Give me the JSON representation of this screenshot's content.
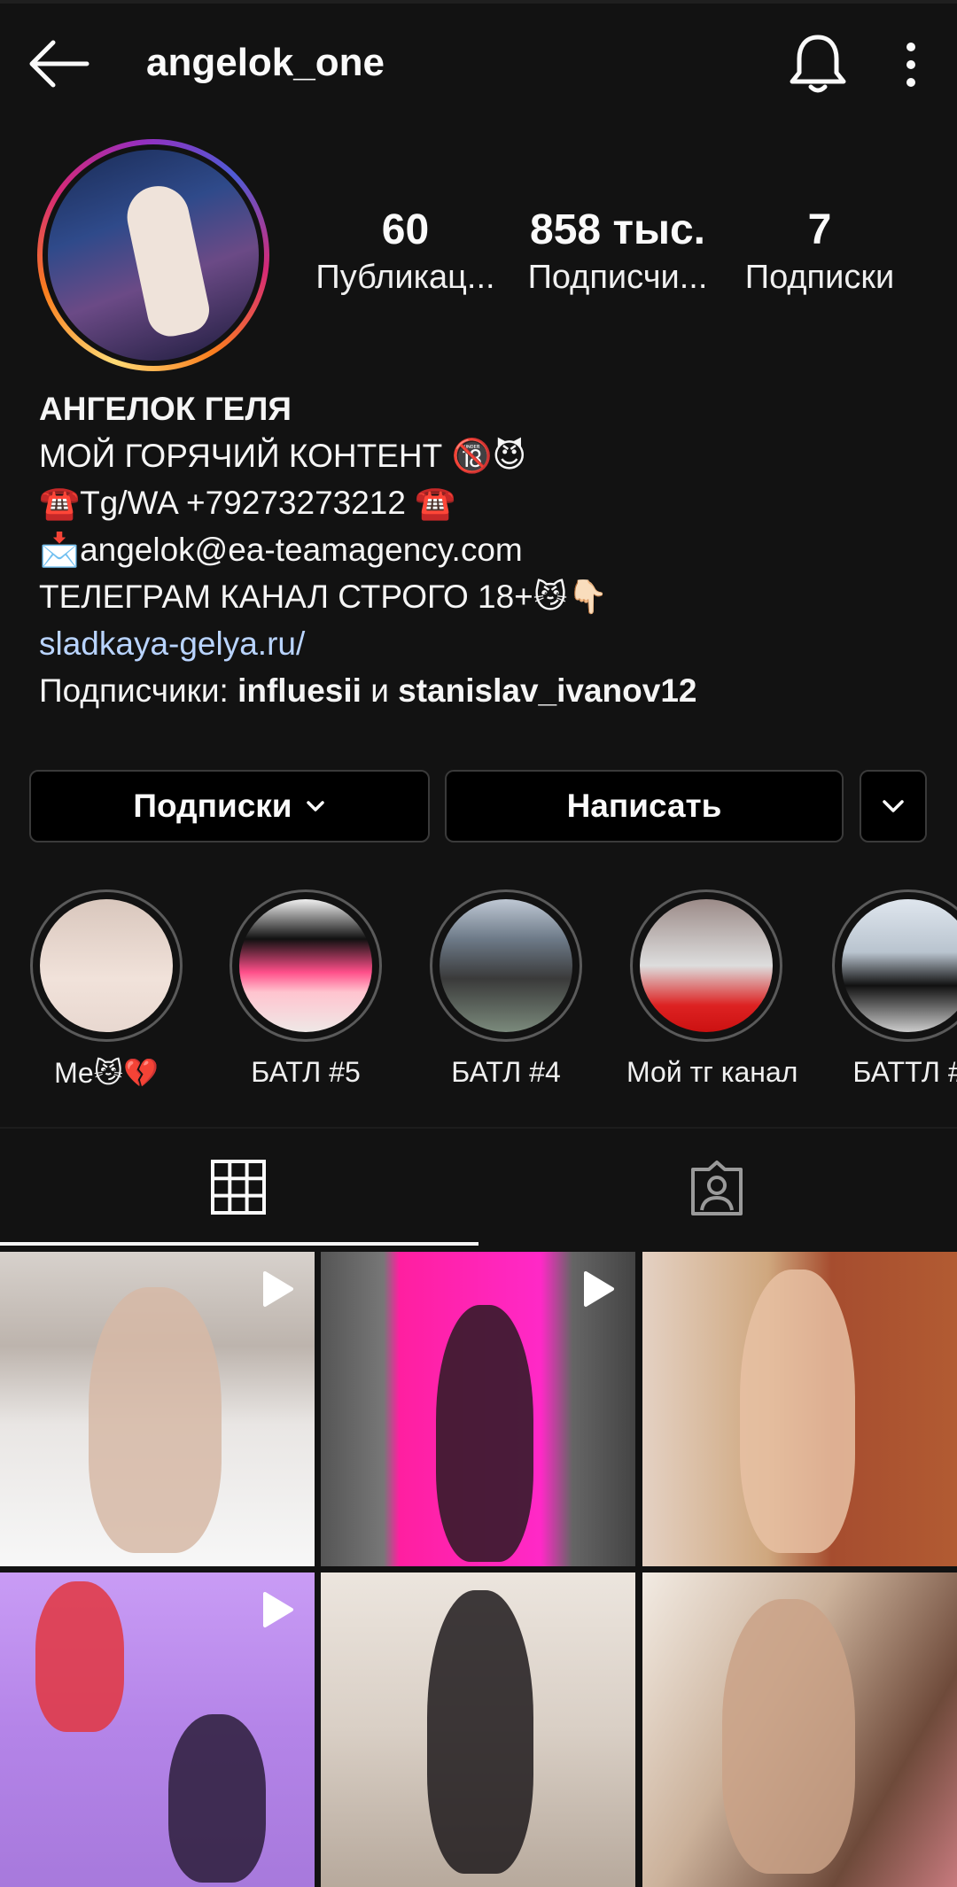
{
  "header": {
    "username": "angelok_one"
  },
  "stats": {
    "posts_count": "60",
    "posts_label": "Публикац...",
    "followers_count": "858 тыс.",
    "followers_label": "Подписчи...",
    "following_count": "7",
    "following_label": "Подписки"
  },
  "bio": {
    "name": "АНГЕЛОК ГЕЛЯ",
    "line1": "МОЙ ГОРЯЧИЙ КОНТЕНТ 🔞😈",
    "line2": "☎️Tg/WA +79273273212 ☎️",
    "line3": "📩angelok@ea-teamagency.com",
    "line4": "ТЕЛЕГРАМ КАНАЛ СТРОГО 18+😼👇🏻",
    "link": "sladkaya-gelya.ru/",
    "followed_by_prefix": "Подписчики: ",
    "followed_by_user1": "influesii",
    "followed_by_and": " и ",
    "followed_by_user2": "stanislav_ivanov12"
  },
  "actions": {
    "following_label": "Подписки",
    "message_label": "Написать"
  },
  "highlights": [
    {
      "label": "Me😼💔"
    },
    {
      "label": "БАТЛ #5"
    },
    {
      "label": "БАТЛ #4"
    },
    {
      "label": "Мой тг канал"
    },
    {
      "label": "БАТТЛ #"
    }
  ],
  "colors": {
    "background": "#121212",
    "link": "#b9d4ff",
    "button_bg": "#000000",
    "button_border": "#3a3a3a"
  }
}
